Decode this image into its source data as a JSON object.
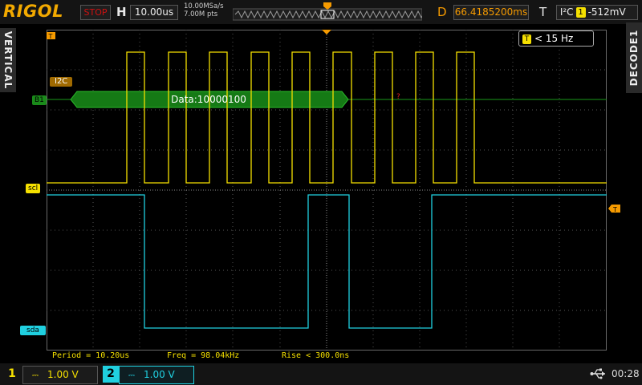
{
  "header": {
    "logo": "RIGOL",
    "run_state": "STOP",
    "h_label": "H",
    "timebase": "10.00us",
    "sample_rate": "10.00MSa/s",
    "memory_depth": "7.00M pts",
    "d_label": "D",
    "trigger_position": "66.4185200ms",
    "t_label": "T",
    "trigger_type": "I²C",
    "trigger_source": "1",
    "trigger_level": "-512mV"
  },
  "side_tabs": {
    "left": "VERTICAL",
    "right": "DECODE1"
  },
  "counter": {
    "icon": "T",
    "text": "< 15 Hz"
  },
  "labels": {
    "bus": "I2C",
    "bus_channel": "B1",
    "scl": "scl",
    "sda": "sda",
    "bus_data": "Data:10000100",
    "bus_error": "?"
  },
  "measurements": {
    "period": "Period = 10.20us",
    "freq": "Freq = 98.04kHz",
    "rise": "Rise < 300.0ns"
  },
  "channels": [
    {
      "number": "1",
      "coupling": "⎓",
      "scale": "1.00 V",
      "color": "#f5e000"
    },
    {
      "number": "2",
      "coupling": "⎓",
      "scale": "1.00 V",
      "color": "#20d0e0"
    }
  ],
  "status": {
    "usb_icon": "usb-icon",
    "clock": "00:28"
  },
  "colors": {
    "ch1": "#f5e000",
    "ch2": "#20d0e0",
    "bus": "#1a8a1a",
    "trigger": "#f59a00",
    "logo": "#f2a900",
    "stop": "#d01010"
  }
}
